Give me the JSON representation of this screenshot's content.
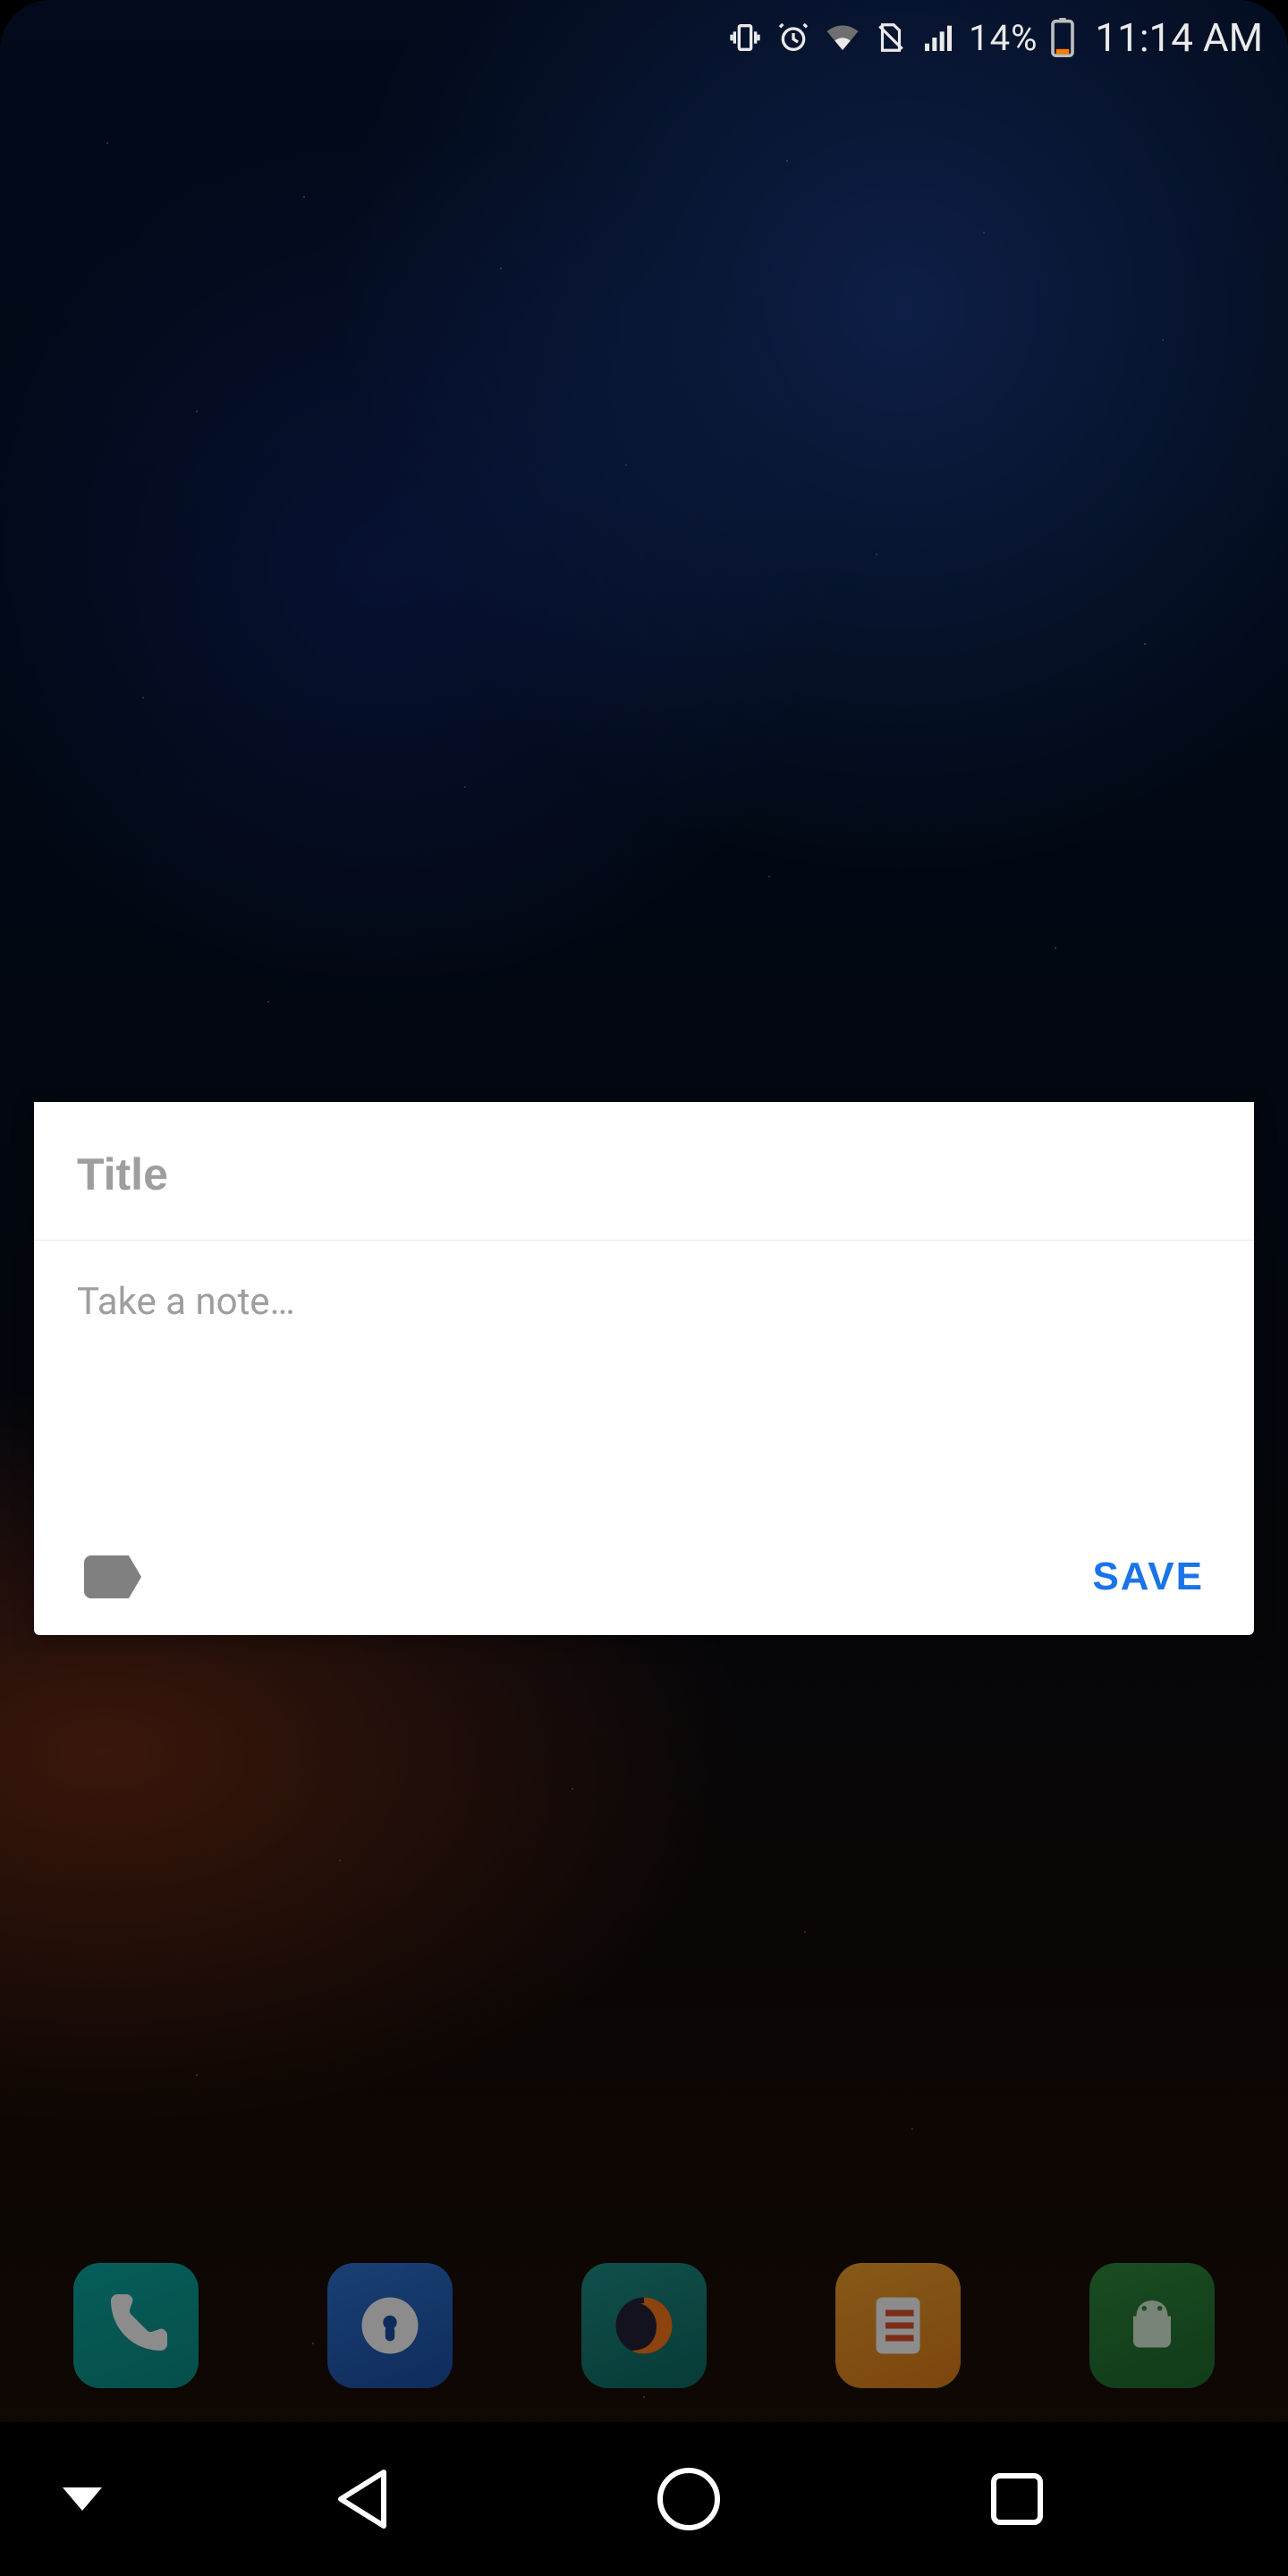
{
  "statusbar": {
    "battery_pct": "14%",
    "clock": "11:14 AM"
  },
  "note_card": {
    "title_placeholder": "Title",
    "title_value": "",
    "body_placeholder": "Take a note…",
    "body_value": "",
    "save_label": "SAVE"
  },
  "dock": {
    "apps": [
      {
        "name": "Phone"
      },
      {
        "name": "Signal"
      },
      {
        "name": "Firefox"
      },
      {
        "name": "Notes"
      },
      {
        "name": "Android System"
      }
    ]
  }
}
